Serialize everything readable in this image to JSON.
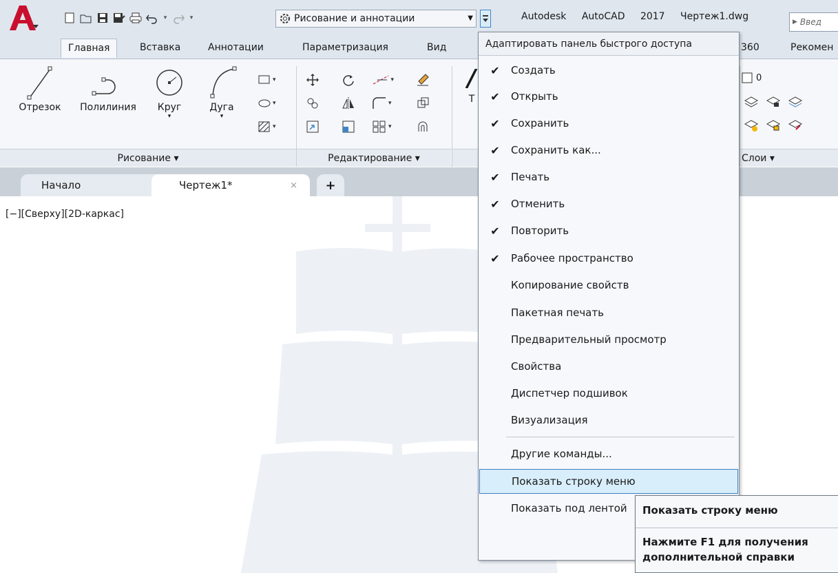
{
  "title_bar": {
    "app_title": "Autodesk AutoCAD 2017 Чертеж1.dwg",
    "search_placeholder": "Введ",
    "workspace": "Рисование и аннотации",
    "qa_icons": [
      "new-icon",
      "open-icon",
      "save-icon",
      "save-as-icon",
      "plot-icon",
      "undo-icon",
      "redo-icon"
    ]
  },
  "ribbon_tabs": [
    "Главная",
    "Вставка",
    "Аннотации",
    "Параметризация",
    "Вид",
    "360",
    "Рекомен"
  ],
  "ribbon": {
    "draw_tools": [
      "Отрезок",
      "Полилиния",
      "Круг",
      "Дуга"
    ],
    "panels": [
      "Рисование ▾",
      "Редактирование ▾",
      "Слои ▾"
    ],
    "text_tool_partial": "Т",
    "layer_value": "0"
  },
  "doc_tabs": {
    "start": "Начало",
    "drawing": "Чертеж1*",
    "close": "×",
    "add": "+"
  },
  "viewport_label": "[−][Сверху][2D-каркас]",
  "qa_menu": {
    "header": "Адаптировать панель быстрого доступа",
    "items": [
      {
        "label": "Создать",
        "checked": true
      },
      {
        "label": "Открыть",
        "checked": true
      },
      {
        "label": "Сохранить",
        "checked": true
      },
      {
        "label": "Сохранить как...",
        "checked": true
      },
      {
        "label": "Печать",
        "checked": true
      },
      {
        "label": "Отменить",
        "checked": true
      },
      {
        "label": "Повторить",
        "checked": true
      },
      {
        "label": "Рабочее пространство",
        "checked": true
      },
      {
        "label": "Копирование свойств",
        "checked": false
      },
      {
        "label": "Пакетная печать",
        "checked": false
      },
      {
        "label": "Предварительный просмотр",
        "checked": false
      },
      {
        "label": "Свойства",
        "checked": false
      },
      {
        "label": "Диспетчер подшивок",
        "checked": false
      },
      {
        "label": "Визуализация",
        "checked": false
      }
    ],
    "other": "Другие команды...",
    "show_menubar": "Показать строку меню",
    "show_below": "Показать под лентой",
    "check_glyph": "✔"
  },
  "tooltip": {
    "title": "Показать строку меню",
    "help": "Нажмите F1 для получения дополнительной справки"
  },
  "colors": {
    "accent_red": "#c8102e",
    "highlight": "#d8eefb",
    "ribbon_bg": "#f5f7fa"
  }
}
